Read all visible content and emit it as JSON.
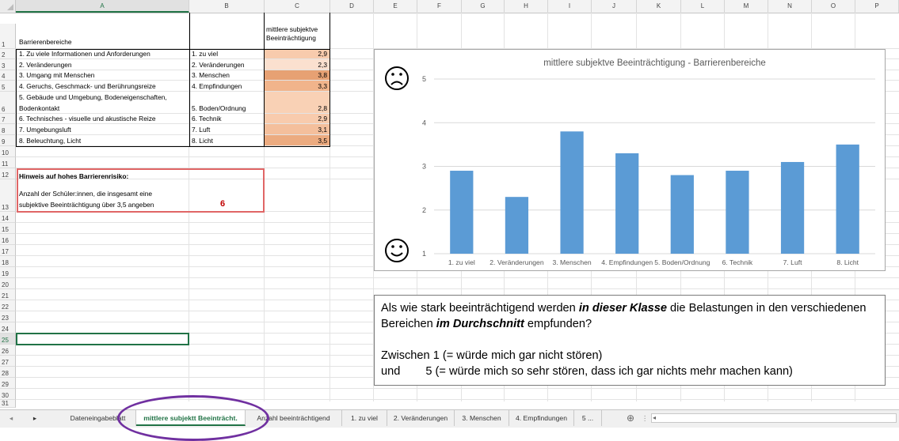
{
  "columns": [
    "A",
    "B",
    "C",
    "D",
    "E",
    "F",
    "G",
    "H",
    "I",
    "J",
    "K",
    "L",
    "M",
    "N",
    "O",
    "P"
  ],
  "rows": [
    "1",
    "2",
    "3",
    "4",
    "5",
    "6",
    "7",
    "8",
    "9",
    "10",
    "11",
    "12",
    "13",
    "14",
    "15",
    "16",
    "17",
    "18",
    "19",
    "20",
    "21",
    "22",
    "23",
    "24",
    "25",
    "26",
    "27",
    "28",
    "29",
    "30",
    "31"
  ],
  "table": {
    "header_a": "Barrierenbereiche",
    "header_c": "mittlere subjektve Beeinträchtigung",
    "rows": [
      {
        "a": "1. Zu viele Informationen und Anforderungen",
        "b": "1. zu viel",
        "c": "2,9"
      },
      {
        "a": "2. Veränderungen",
        "b": "2. Veränderungen",
        "c": "2,3"
      },
      {
        "a": "3. Umgang mit Menschen",
        "b": "3. Menschen",
        "c": "3,8"
      },
      {
        "a": "4. Geruchs, Geschmack- und Berührungsreize",
        "b": "4. Empfindungen",
        "c": "3,3"
      },
      {
        "a": "5. Gebäude und Umgebung, Bodeneigenschaften,",
        "a2": "Bodenkontakt",
        "b": "5. Boden/Ordnung",
        "c": "2,8"
      },
      {
        "a": "6. Technisches - visuelle und akustische Reize",
        "b": "6. Technik",
        "c": "2,9"
      },
      {
        "a": "7. Umgebungsluft",
        "b": "7. Luft",
        "c": "3,1"
      },
      {
        "a": "8. Beleuchtung, Licht",
        "b": "8. Licht",
        "c": "3,5"
      }
    ],
    "heat_colors": [
      "#f8cbad",
      "#fbe0cf",
      "#e7a173",
      "#f1b48b",
      "#f9d1b5",
      "#f8cbad",
      "#f4bf9c",
      "#ecab80"
    ]
  },
  "hint": {
    "title": "Hinweis auf hohes Barrierenrisiko:",
    "line1": "Anzahl der Schüler:innen, die insgesamt eine",
    "line2": "subjektive Beeinträchtigung über 3,5 angeben",
    "count": "6",
    "border_color": "#e06666",
    "count_color": "#c00000"
  },
  "chart_data": {
    "type": "bar",
    "title": "mittlere subjektve Beeinträchtigung - Barrierenbereiche",
    "categories": [
      "1. zu viel",
      "2. Veränderungen",
      "3. Menschen",
      "4. Empfindungen",
      "5. Boden/Ordnung",
      "6. Technik",
      "7. Luft",
      "8. Licht"
    ],
    "values": [
      2.9,
      2.3,
      3.8,
      3.3,
      2.8,
      2.9,
      3.1,
      3.5
    ],
    "ylim": [
      1,
      5
    ],
    "yticks": [
      "1",
      "2",
      "3",
      "4",
      "5"
    ],
    "grid": true,
    "bar_color": "#5b9bd5",
    "icons": [
      "sad-face-icon",
      "smiley-face-icon"
    ]
  },
  "textbox": {
    "p1_a": "Als wie stark beeinträchtigend werden ",
    "p1_b": "in dieser Klasse",
    "p1_c": " die Belastungen in den verschiedenen",
    "p2_a": "Bereichen ",
    "p2_b": "im Durchschnitt",
    "p2_c": " empfunden?",
    "p3": "Zwischen 1 (= würde mich gar nicht stören)",
    "p4_a": "und",
    "p4_b": "5 (= würde mich so sehr stören, dass ich gar nichts mehr machen kann)"
  },
  "tabs": {
    "items": [
      "Dateneingabeblatt",
      "mittlere subjektt Beeinträcht.",
      "Anzahl beeinträchtigend",
      "1. zu viel",
      "2. Veränderungen",
      "3. Menschen",
      "4. Empfindungen",
      "5 ..."
    ],
    "active_index": 1,
    "add_symbol": "⊕",
    "nav_prev": "◂",
    "nav_next": "▸",
    "more_symbol": "⋮"
  },
  "accent_color": "#217346",
  "highlight_color": "#7030a0"
}
